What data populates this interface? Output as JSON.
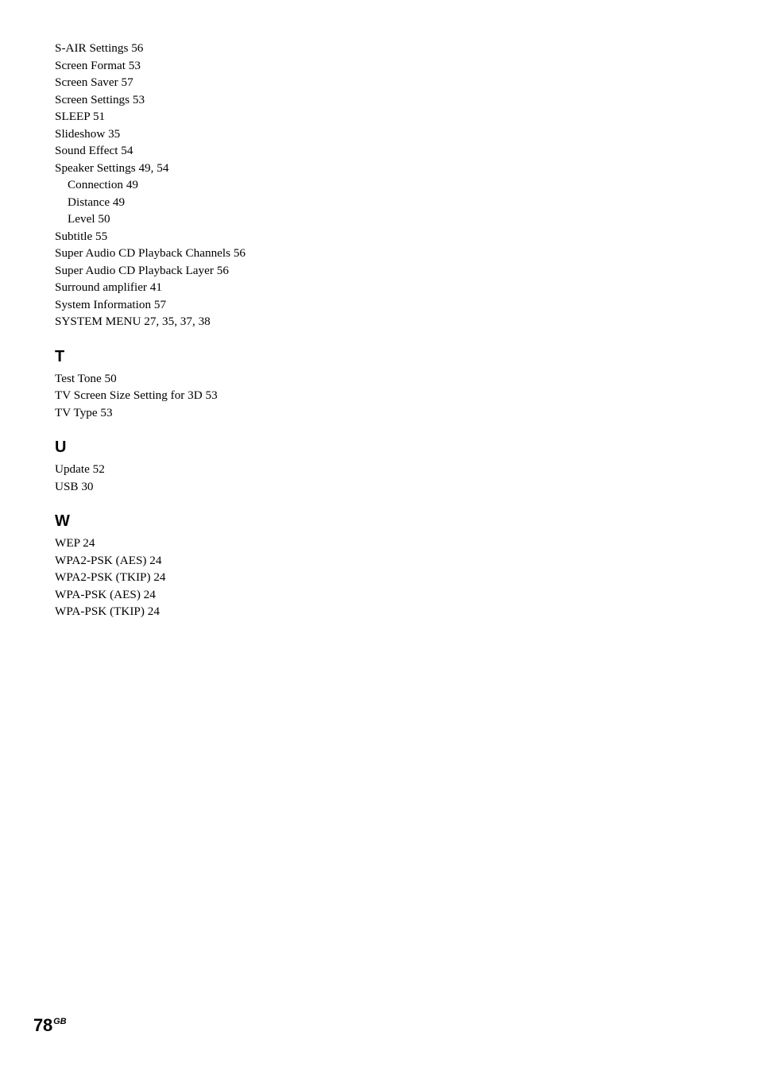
{
  "document": {
    "page_number": "78",
    "page_number_suffix": "GB"
  },
  "index": {
    "sections": [
      {
        "heading": "",
        "entries": [
          {
            "text": "S-AIR Settings 56",
            "level": 0
          },
          {
            "text": "Screen Format 53",
            "level": 0
          },
          {
            "text": "Screen Saver 57",
            "level": 0
          },
          {
            "text": "Screen Settings 53",
            "level": 0
          },
          {
            "text": "SLEEP 51",
            "level": 0
          },
          {
            "text": "Slideshow 35",
            "level": 0
          },
          {
            "text": "Sound Effect 54",
            "level": 0
          },
          {
            "text": "Speaker Settings 49, 54",
            "level": 0
          },
          {
            "text": "Connection 49",
            "level": 1
          },
          {
            "text": "Distance 49",
            "level": 1
          },
          {
            "text": "Level 50",
            "level": 1
          },
          {
            "text": "Subtitle 55",
            "level": 0
          },
          {
            "text": "Super Audio CD Playback Channels 56",
            "level": 0
          },
          {
            "text": "Super Audio CD Playback Layer 56",
            "level": 0
          },
          {
            "text": "Surround amplifier 41",
            "level": 0
          },
          {
            "text": "System Information 57",
            "level": 0
          },
          {
            "text": "SYSTEM MENU 27, 35, 37, 38",
            "level": 0
          }
        ]
      },
      {
        "heading": "T",
        "entries": [
          {
            "text": "Test Tone 50",
            "level": 0
          },
          {
            "text": "TV Screen Size Setting for 3D 53",
            "level": 0
          },
          {
            "text": "TV Type 53",
            "level": 0
          }
        ]
      },
      {
        "heading": "U",
        "entries": [
          {
            "text": "Update 52",
            "level": 0
          },
          {
            "text": "USB 30",
            "level": 0
          }
        ]
      },
      {
        "heading": "W",
        "entries": [
          {
            "text": "WEP 24",
            "level": 0
          },
          {
            "text": "WPA2-PSK (AES) 24",
            "level": 0
          },
          {
            "text": "WPA2-PSK (TKIP) 24",
            "level": 0
          },
          {
            "text": "WPA-PSK (AES) 24",
            "level": 0
          },
          {
            "text": "WPA-PSK (TKIP) 24",
            "level": 0
          }
        ]
      }
    ]
  },
  "colors": {
    "page_background": "#ffffff",
    "text": "#000000"
  }
}
